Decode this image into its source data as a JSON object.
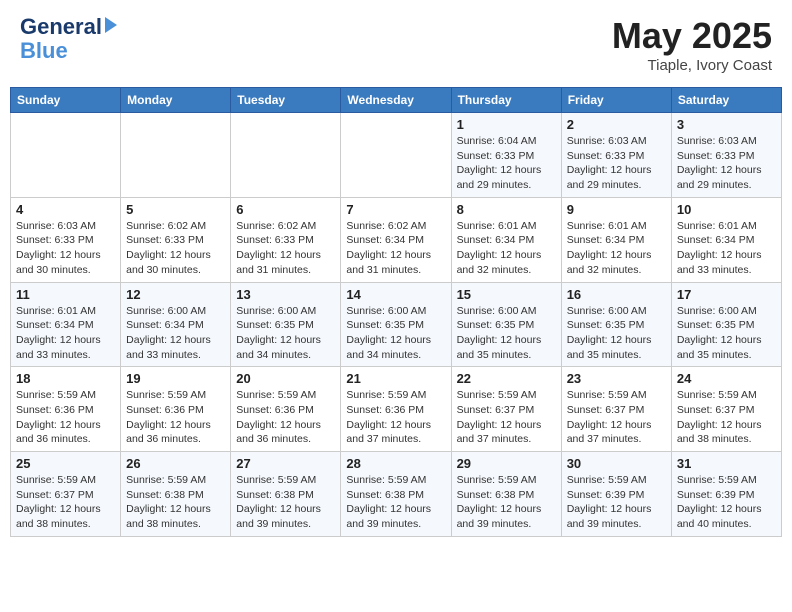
{
  "header": {
    "logo_line1": "General",
    "logo_line2": "Blue",
    "title": "May 2025",
    "subtitle": "Tiaple, Ivory Coast"
  },
  "weekdays": [
    "Sunday",
    "Monday",
    "Tuesday",
    "Wednesday",
    "Thursday",
    "Friday",
    "Saturday"
  ],
  "weeks": [
    [
      {
        "day": "",
        "info": ""
      },
      {
        "day": "",
        "info": ""
      },
      {
        "day": "",
        "info": ""
      },
      {
        "day": "",
        "info": ""
      },
      {
        "day": "1",
        "info": "Sunrise: 6:04 AM\nSunset: 6:33 PM\nDaylight: 12 hours\nand 29 minutes."
      },
      {
        "day": "2",
        "info": "Sunrise: 6:03 AM\nSunset: 6:33 PM\nDaylight: 12 hours\nand 29 minutes."
      },
      {
        "day": "3",
        "info": "Sunrise: 6:03 AM\nSunset: 6:33 PM\nDaylight: 12 hours\nand 29 minutes."
      }
    ],
    [
      {
        "day": "4",
        "info": "Sunrise: 6:03 AM\nSunset: 6:33 PM\nDaylight: 12 hours\nand 30 minutes."
      },
      {
        "day": "5",
        "info": "Sunrise: 6:02 AM\nSunset: 6:33 PM\nDaylight: 12 hours\nand 30 minutes."
      },
      {
        "day": "6",
        "info": "Sunrise: 6:02 AM\nSunset: 6:33 PM\nDaylight: 12 hours\nand 31 minutes."
      },
      {
        "day": "7",
        "info": "Sunrise: 6:02 AM\nSunset: 6:34 PM\nDaylight: 12 hours\nand 31 minutes."
      },
      {
        "day": "8",
        "info": "Sunrise: 6:01 AM\nSunset: 6:34 PM\nDaylight: 12 hours\nand 32 minutes."
      },
      {
        "day": "9",
        "info": "Sunrise: 6:01 AM\nSunset: 6:34 PM\nDaylight: 12 hours\nand 32 minutes."
      },
      {
        "day": "10",
        "info": "Sunrise: 6:01 AM\nSunset: 6:34 PM\nDaylight: 12 hours\nand 33 minutes."
      }
    ],
    [
      {
        "day": "11",
        "info": "Sunrise: 6:01 AM\nSunset: 6:34 PM\nDaylight: 12 hours\nand 33 minutes."
      },
      {
        "day": "12",
        "info": "Sunrise: 6:00 AM\nSunset: 6:34 PM\nDaylight: 12 hours\nand 33 minutes."
      },
      {
        "day": "13",
        "info": "Sunrise: 6:00 AM\nSunset: 6:35 PM\nDaylight: 12 hours\nand 34 minutes."
      },
      {
        "day": "14",
        "info": "Sunrise: 6:00 AM\nSunset: 6:35 PM\nDaylight: 12 hours\nand 34 minutes."
      },
      {
        "day": "15",
        "info": "Sunrise: 6:00 AM\nSunset: 6:35 PM\nDaylight: 12 hours\nand 35 minutes."
      },
      {
        "day": "16",
        "info": "Sunrise: 6:00 AM\nSunset: 6:35 PM\nDaylight: 12 hours\nand 35 minutes."
      },
      {
        "day": "17",
        "info": "Sunrise: 6:00 AM\nSunset: 6:35 PM\nDaylight: 12 hours\nand 35 minutes."
      }
    ],
    [
      {
        "day": "18",
        "info": "Sunrise: 5:59 AM\nSunset: 6:36 PM\nDaylight: 12 hours\nand 36 minutes."
      },
      {
        "day": "19",
        "info": "Sunrise: 5:59 AM\nSunset: 6:36 PM\nDaylight: 12 hours\nand 36 minutes."
      },
      {
        "day": "20",
        "info": "Sunrise: 5:59 AM\nSunset: 6:36 PM\nDaylight: 12 hours\nand 36 minutes."
      },
      {
        "day": "21",
        "info": "Sunrise: 5:59 AM\nSunset: 6:36 PM\nDaylight: 12 hours\nand 37 minutes."
      },
      {
        "day": "22",
        "info": "Sunrise: 5:59 AM\nSunset: 6:37 PM\nDaylight: 12 hours\nand 37 minutes."
      },
      {
        "day": "23",
        "info": "Sunrise: 5:59 AM\nSunset: 6:37 PM\nDaylight: 12 hours\nand 37 minutes."
      },
      {
        "day": "24",
        "info": "Sunrise: 5:59 AM\nSunset: 6:37 PM\nDaylight: 12 hours\nand 38 minutes."
      }
    ],
    [
      {
        "day": "25",
        "info": "Sunrise: 5:59 AM\nSunset: 6:37 PM\nDaylight: 12 hours\nand 38 minutes."
      },
      {
        "day": "26",
        "info": "Sunrise: 5:59 AM\nSunset: 6:38 PM\nDaylight: 12 hours\nand 38 minutes."
      },
      {
        "day": "27",
        "info": "Sunrise: 5:59 AM\nSunset: 6:38 PM\nDaylight: 12 hours\nand 39 minutes."
      },
      {
        "day": "28",
        "info": "Sunrise: 5:59 AM\nSunset: 6:38 PM\nDaylight: 12 hours\nand 39 minutes."
      },
      {
        "day": "29",
        "info": "Sunrise: 5:59 AM\nSunset: 6:38 PM\nDaylight: 12 hours\nand 39 minutes."
      },
      {
        "day": "30",
        "info": "Sunrise: 5:59 AM\nSunset: 6:39 PM\nDaylight: 12 hours\nand 39 minutes."
      },
      {
        "day": "31",
        "info": "Sunrise: 5:59 AM\nSunset: 6:39 PM\nDaylight: 12 hours\nand 40 minutes."
      }
    ]
  ]
}
